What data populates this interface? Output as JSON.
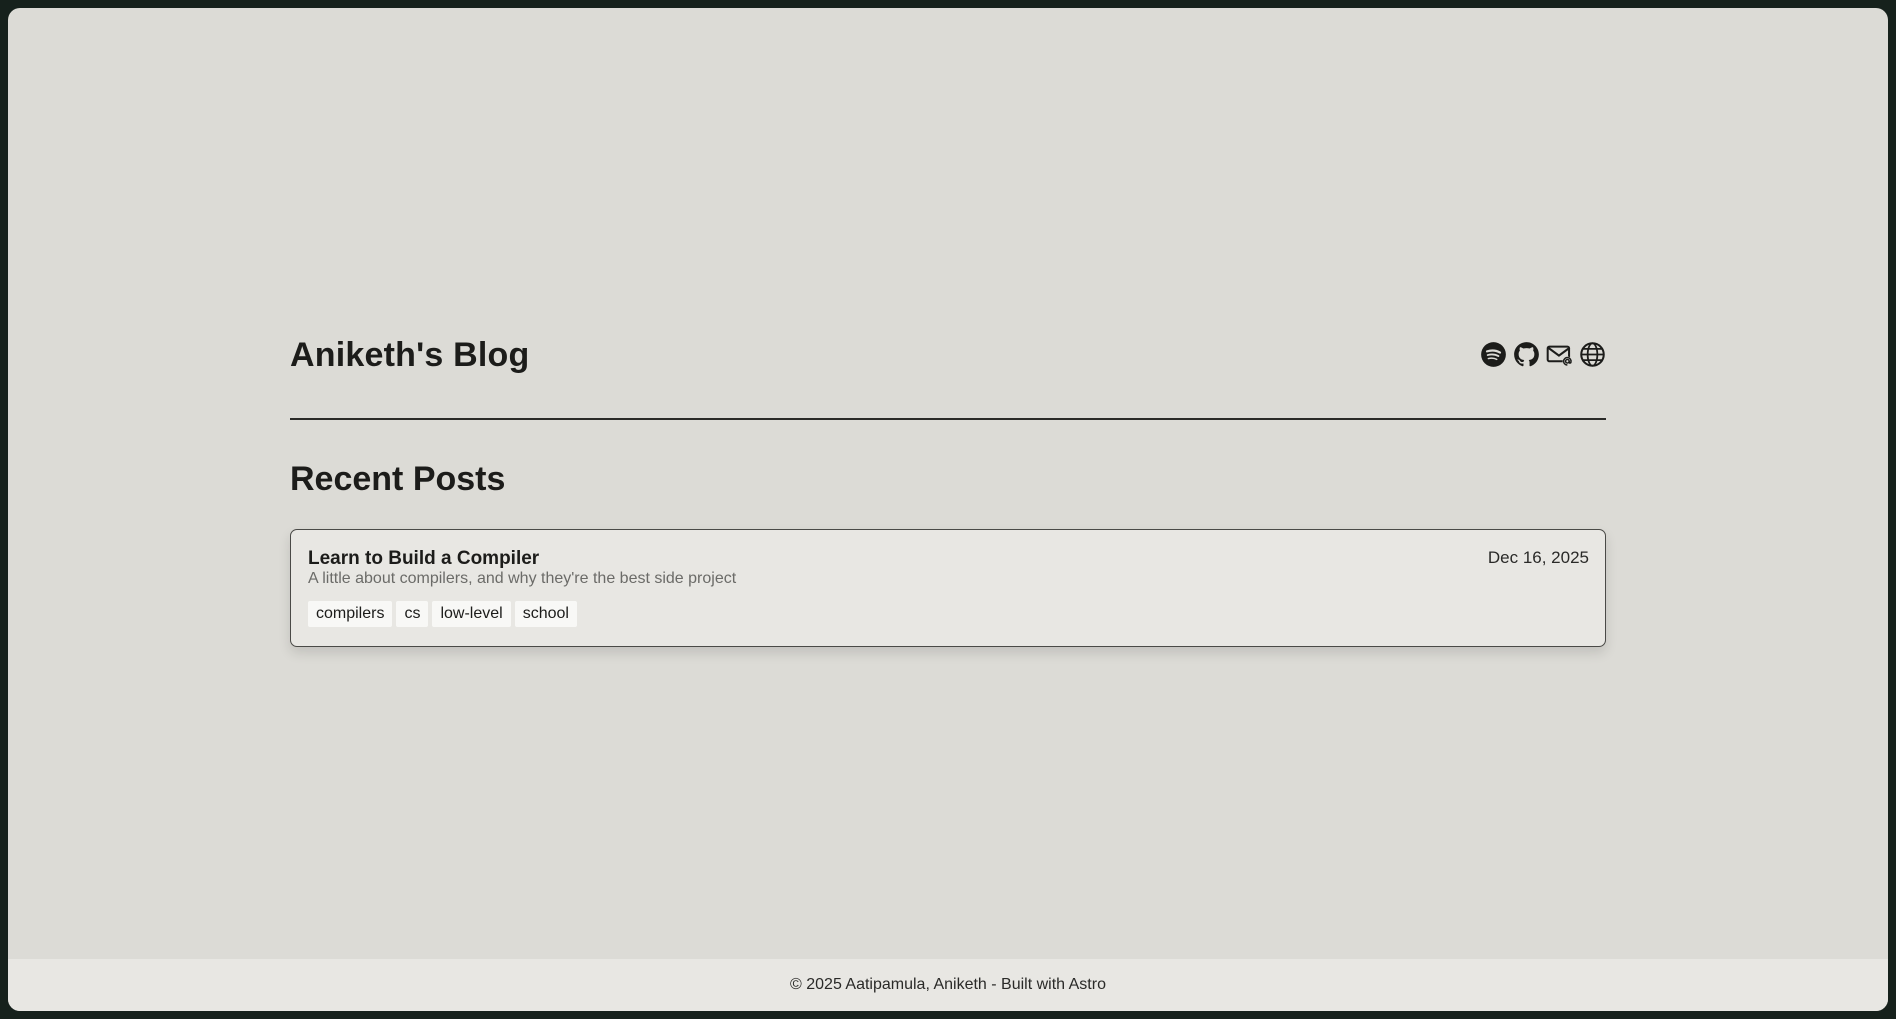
{
  "site": {
    "title": "Aniketh's Blog"
  },
  "social": [
    {
      "name": "spotify",
      "icon": "spotify-icon"
    },
    {
      "name": "github",
      "icon": "github-icon"
    },
    {
      "name": "email",
      "icon": "mail-icon"
    },
    {
      "name": "website",
      "icon": "globe-icon"
    }
  ],
  "main": {
    "section_title": "Recent Posts",
    "posts": [
      {
        "title": "Learn to Build a Compiler",
        "date": "Dec 16, 2025",
        "description": "A little about compilers, and why they're the best side project",
        "tags": [
          "compilers",
          "cs",
          "low-level",
          "school"
        ]
      }
    ]
  },
  "footer": {
    "text": "© 2025 Aatipamula, Aniketh - Built with Astro"
  },
  "colors": {
    "background": "#dcdbd6",
    "card": "#e8e7e3",
    "text": "#1c1c1a",
    "muted": "#6b6b68"
  }
}
